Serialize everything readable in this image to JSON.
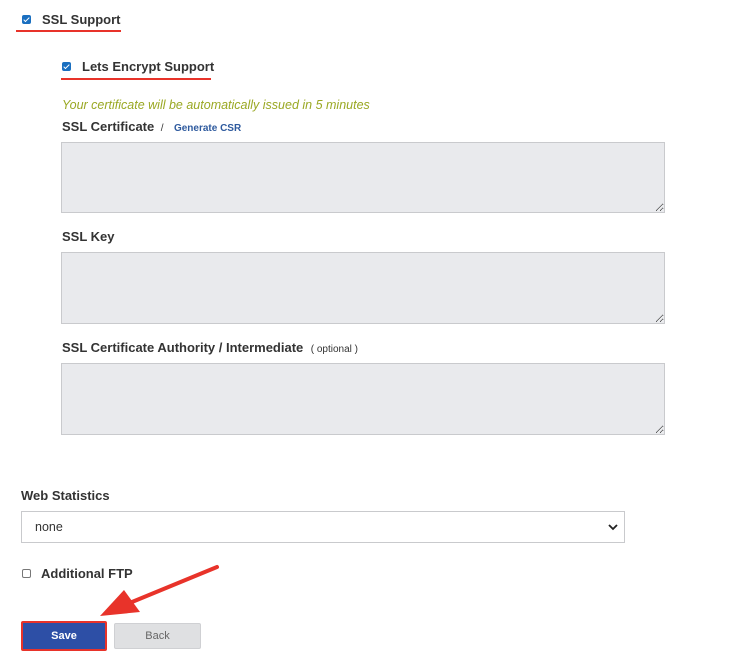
{
  "ssl": {
    "support_label": "SSL Support",
    "support_checked": true,
    "letsencrypt_label": "Lets Encrypt Support",
    "letsencrypt_checked": true,
    "auto_note": "Your certificate will be automatically issued in 5 minutes",
    "certificate_label": "SSL Certificate",
    "certificate_separator": "/",
    "generate_csr_link": "Generate CSR",
    "certificate_value": "",
    "key_label": "SSL Key",
    "key_value": "",
    "authority_label": "SSL Certificate Authority / Intermediate",
    "authority_optional": "( optional )",
    "authority_value": ""
  },
  "web_statistics": {
    "label": "Web Statistics",
    "selected": "none"
  },
  "additional_ftp": {
    "label": "Additional FTP",
    "checked": false
  },
  "actions": {
    "save_label": "Save",
    "back_label": "Back"
  },
  "colors": {
    "highlight": "#e8332a",
    "checkbox_blue": "#1a6fc0",
    "note_green": "#9aa823",
    "save_blue": "#2d4fa6"
  }
}
